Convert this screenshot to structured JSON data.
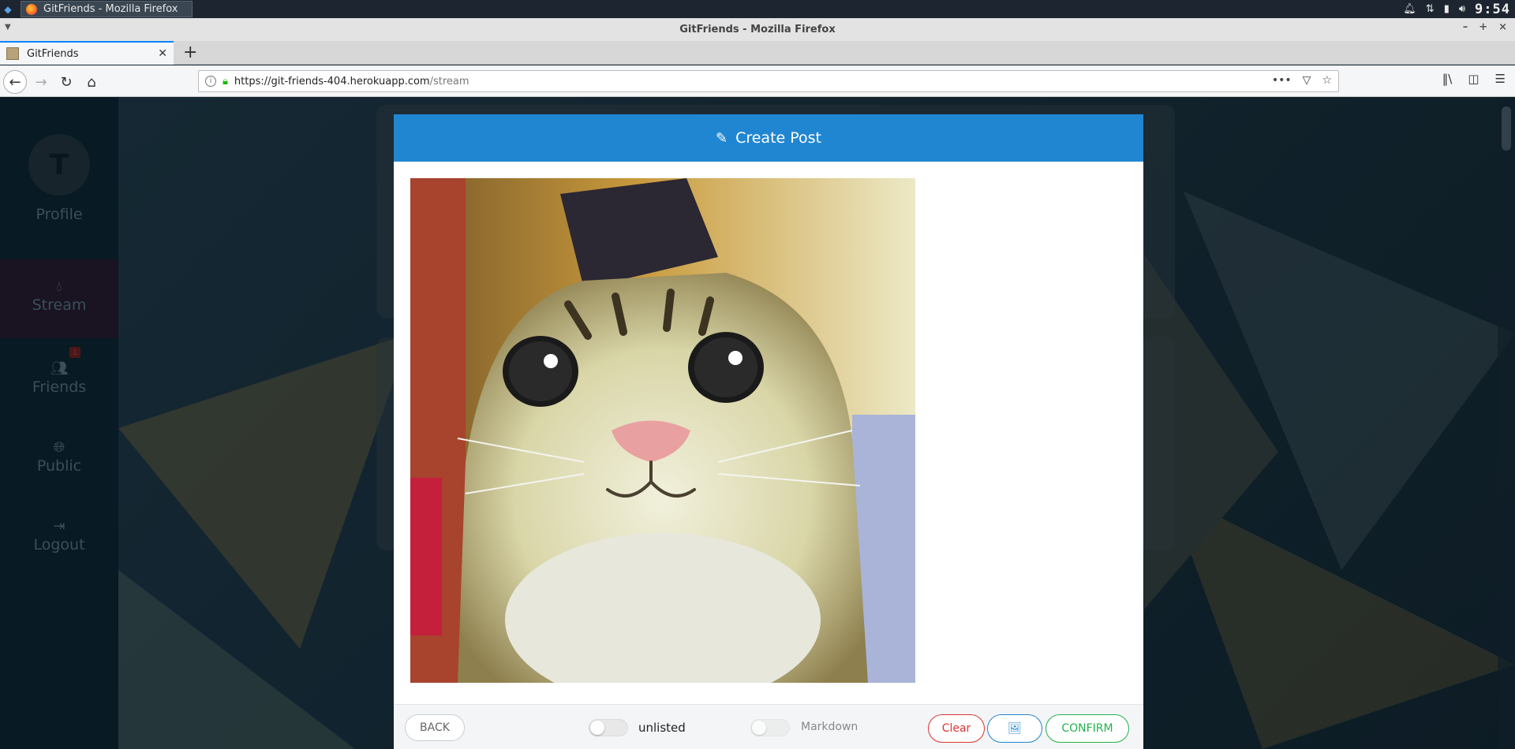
{
  "os": {
    "task_title": "GitFriends - Mozilla Firefox",
    "clock": "9:54"
  },
  "browser": {
    "window_title": "GitFriends - Mozilla Firefox",
    "tab_title": "GitFriends",
    "url_host": "https://git-friends-404.herokuapp.com",
    "url_path": "/stream"
  },
  "sidebar": {
    "avatar_initial": "T",
    "items": [
      {
        "label": "Profile",
        "icon": "user-icon"
      },
      {
        "label": "Stream",
        "icon": "drop-icon"
      },
      {
        "label": "Friends",
        "icon": "users-icon",
        "badge": "1"
      },
      {
        "label": "Public",
        "icon": "globe-icon"
      },
      {
        "label": "Logout",
        "icon": "sign-out-icon"
      }
    ]
  },
  "modal": {
    "title": "Create Post",
    "title_icon": "pencil-icon",
    "image_alt": "smiling cat photo",
    "footer": {
      "back_label": "BACK",
      "unlisted_label": "unlisted",
      "unlisted_on": false,
      "markdown_label": "Markdown",
      "markdown_on": false,
      "clear_label": "Clear",
      "image_button_icon": "image-icon",
      "confirm_label": "CONFIRM"
    }
  }
}
